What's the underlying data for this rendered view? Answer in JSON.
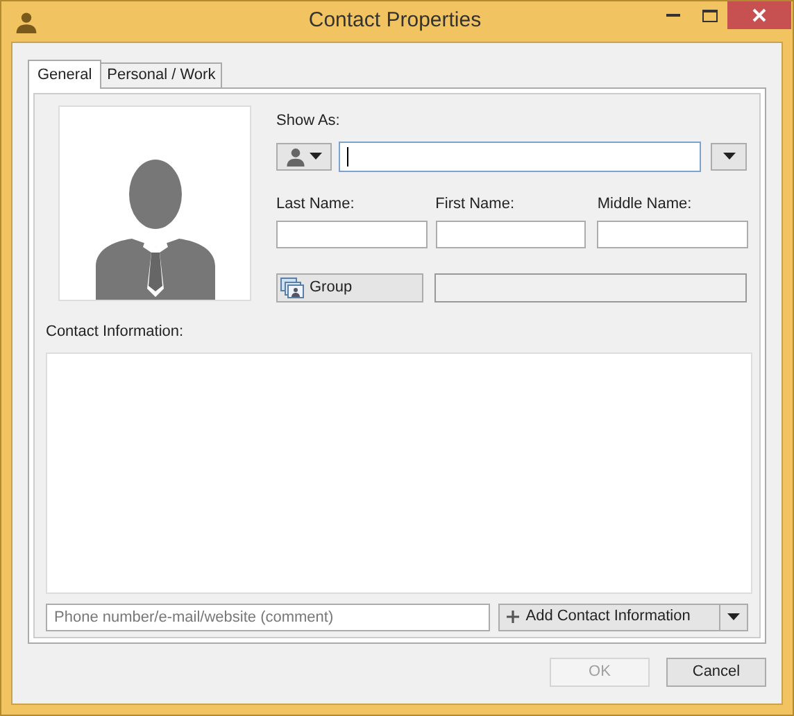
{
  "window": {
    "title": "Contact Properties"
  },
  "tabs": [
    {
      "label": "General",
      "selected": true
    },
    {
      "label": "Personal / Work",
      "selected": false
    }
  ],
  "show_as": {
    "label": "Show As:"
  },
  "name_fields": [
    {
      "label": "Last Name:"
    },
    {
      "label": "First Name:"
    },
    {
      "label": "Middle Name:"
    }
  ],
  "group_button": {
    "label": "Group"
  },
  "contact_information": {
    "label": "Contact Information:",
    "placeholder": "Phone number/e-mail/website (comment)",
    "add_button": "Add Contact Information"
  },
  "buttons": [
    {
      "label": "OK",
      "disabled": true
    },
    {
      "label": "Cancel",
      "disabled": false
    }
  ]
}
